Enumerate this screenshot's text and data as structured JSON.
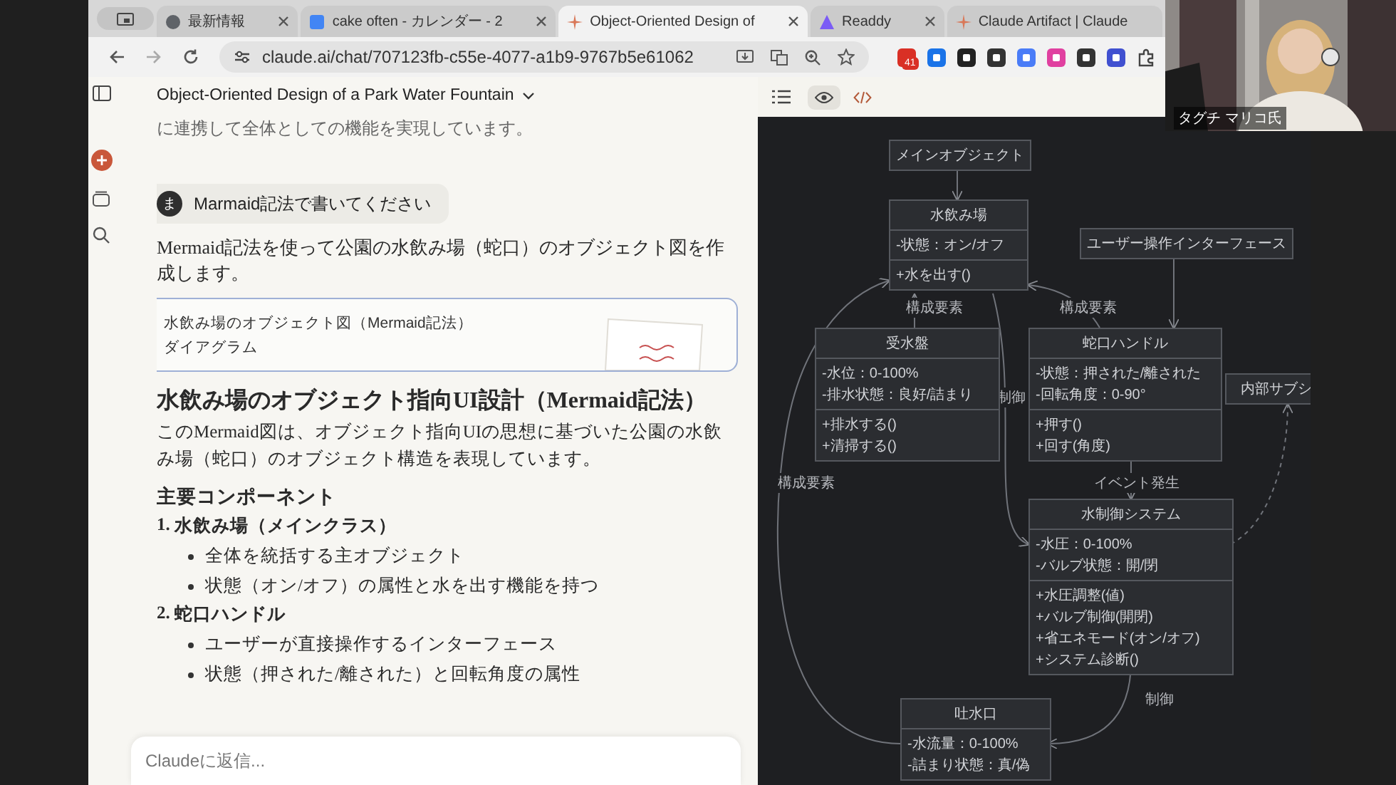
{
  "browser": {
    "tabs": [
      {
        "title": "最新情報",
        "selected": false
      },
      {
        "title": "cake often - カレンダー - 2",
        "selected": false
      },
      {
        "title": "Object-Oriented Design of",
        "selected": true
      },
      {
        "title": "Readdy",
        "selected": false
      },
      {
        "title": "Claude Artifact | Claude",
        "selected": false
      }
    ],
    "url": "claude.ai/chat/707123fb-c55e-4077-a1b9-9767b5e61062",
    "extension_badge": "41"
  },
  "chat": {
    "title": "Object-Oriented Design of a Park Water Fountain",
    "prior_text": "に連携して全体としての機能を実現しています。",
    "user_message": {
      "avatar": "ま",
      "text": "Marmaid記法で書いてください"
    },
    "reply_intro": "Mermaid記法を使って公園の水飲み場（蛇口）のオブジェクト図を作成します。",
    "artifact": {
      "title": "水飲み場のオブジェクト図（Mermaid記法）",
      "type": "ダイアグラム"
    },
    "heading": "水飲み場のオブジェクト指向UI設計（Mermaid記法）",
    "paragraph": "このMermaid図は、オブジェクト指向UIの思想に基づいた公園の水飲み場（蛇口）のオブジェクト構造を表現しています。",
    "section_heading": "主要コンポーネント",
    "components": [
      {
        "number": "1.",
        "name": "水飲み場（メインクラス）",
        "points": [
          "全体を統括する主オブジェクト",
          "状態（オン/オフ）の属性と水を出す機能を持つ"
        ]
      },
      {
        "number": "2.",
        "name": "蛇口ハンドル",
        "points": [
          "ユーザーが直接操作するインターフェース",
          "状態（押された/離された）と回転角度の属性"
        ]
      }
    ],
    "composer_placeholder": "Claudeに返信..."
  },
  "artifact_panel": {
    "view_toggle": [
      {
        "kind": "preview",
        "selected": true
      },
      {
        "kind": "code",
        "selected": false
      }
    ]
  },
  "diagram": {
    "nodes": [
      {
        "title": "メインオブジェクト"
      },
      {
        "title": "水飲み場",
        "attributes": [
          "-状態：オン/オフ"
        ],
        "methods": [
          "+水を出す()"
        ]
      },
      {
        "title": "ユーザー操作インターフェース"
      },
      {
        "title": "受水盤",
        "attributes": [
          "-水位：0-100%",
          "-排水状態：良好/詰まり"
        ],
        "methods": [
          "+排水する()",
          "+清掃する()"
        ]
      },
      {
        "title": "蛇口ハンドル",
        "attributes": [
          "-状態：押された/離された",
          "-回転角度：0-90°"
        ],
        "methods": [
          "+押す()",
          "+回す(角度)"
        ]
      },
      {
        "title": "内部サブシ"
      },
      {
        "title": "水制御システム",
        "attributes": [
          "-水圧：0-100%",
          "-バルブ状態：開/閉"
        ],
        "methods": [
          "+水圧調整(値)",
          "+バルブ制御(開閉)",
          "+省エネモード(オン/オフ)",
          "+システム診断()"
        ]
      },
      {
        "title": "吐水口",
        "attributes": [
          "-水流量：0-100%",
          "-詰まり状態：真/偽"
        ]
      }
    ],
    "edge_labels": [
      "構成要素",
      "構成要素",
      "制御",
      "構成要素",
      "イベント発生",
      "制御"
    ]
  },
  "webcam": {
    "kind": "picture",
    "caption": "タグチ マリコ氏"
  }
}
